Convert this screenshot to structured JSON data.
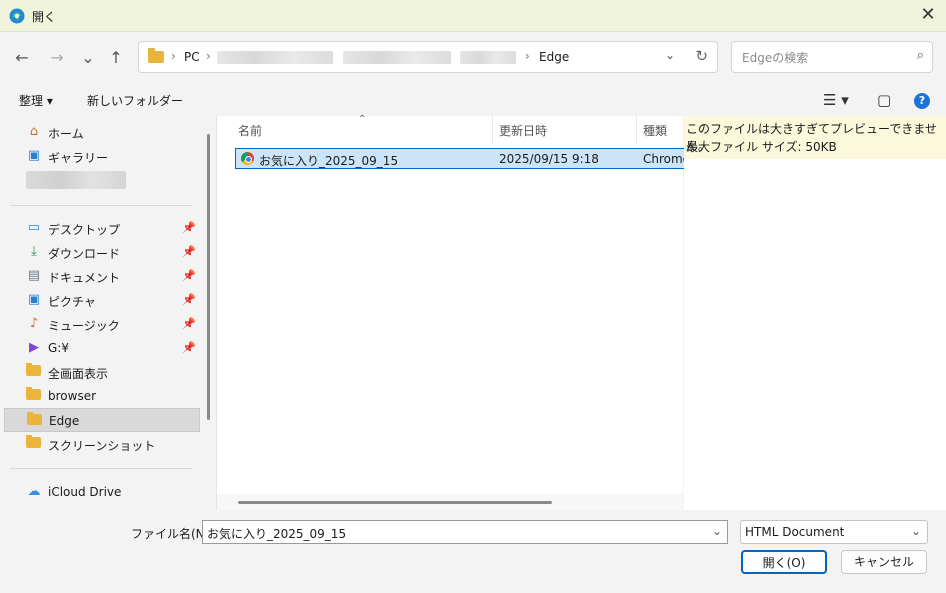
{
  "window": {
    "title": "開く",
    "close_glyph": "✕"
  },
  "nav": {
    "back_glyph": "←",
    "forward_glyph": "→",
    "recent_glyph": "⌄",
    "up_glyph": "↑",
    "breadcrumb": [
      "PC",
      "Edge"
    ],
    "chev": "›",
    "dropdown_glyph": "⌄",
    "refresh_glyph": "↻",
    "search_placeholder": "Edgeの検索",
    "search_glyph": "⌕"
  },
  "toolbar": {
    "organize": "整理 ▾",
    "new_folder": "新しいフォルダー",
    "view_glyph": "☰ ▾",
    "pane_glyph": "▢",
    "help_glyph": "?"
  },
  "sidebar": {
    "pin": "📌",
    "items": [
      {
        "label": "ホーム",
        "icon": "⌂"
      },
      {
        "label": "ギャラリー",
        "icon": "▣"
      },
      {
        "label": "デスクトップ",
        "icon": "▭"
      },
      {
        "label": "ダウンロード",
        "icon": "⤓"
      },
      {
        "label": "ドキュメント",
        "icon": "▤"
      },
      {
        "label": "ピクチャ",
        "icon": "▣"
      },
      {
        "label": "ミュージック",
        "icon": "♪"
      },
      {
        "label": "G:¥",
        "icon": "▶"
      },
      {
        "label": "全画面表示",
        "icon": "folder"
      },
      {
        "label": "browser",
        "icon": "folder"
      },
      {
        "label": "Edge",
        "icon": "folder"
      },
      {
        "label": "スクリーンショット",
        "icon": "folder"
      },
      {
        "label": "iCloud Drive",
        "icon": "☁"
      }
    ]
  },
  "files": {
    "columns": [
      "名前",
      "更新日時",
      "種類"
    ],
    "sort_glyph": "⌃",
    "rows": [
      {
        "name": "お気に入り_2025_09_15",
        "modified": "2025/09/15 9:18",
        "type": "Chrome"
      }
    ]
  },
  "preview": {
    "line1": "このファイルは大きすぎてプレビューできません。",
    "line2": "最大ファイル サイズ: 50KB"
  },
  "bottom": {
    "filename_label": "ファイル名(N):",
    "filename_value": "お気に入り_2025_09_15",
    "filetype": "HTML Document",
    "dd_glyph": "⌄",
    "open_label": "開く(O)",
    "cancel_label": "キャンセル"
  },
  "colors": {
    "accent": "#0067c0",
    "selection": "#cce4f7",
    "title_bg": "#f0f4dc",
    "preview_bg": "#fbf8db"
  }
}
